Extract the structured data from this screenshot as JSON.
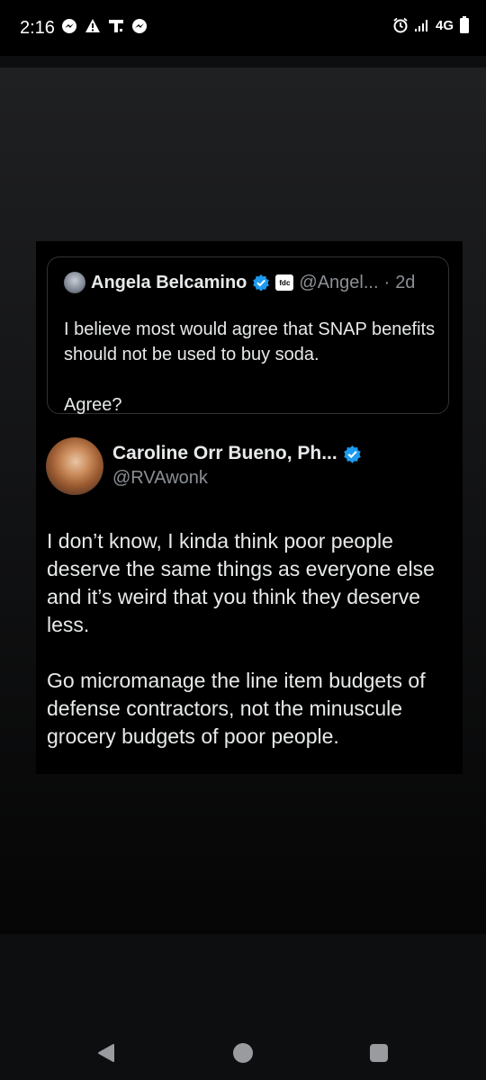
{
  "status_bar": {
    "time": "2:16",
    "left_icons": [
      "messenger-icon",
      "warning-icon",
      "t-icon",
      "messenger-icon"
    ],
    "network": "4G",
    "right_icons": [
      "alarm-icon",
      "signal-icon",
      "battery-icon"
    ]
  },
  "quoted_tweet": {
    "name": "Angela Belcamino",
    "verified": true,
    "affiliation_badge_text": "fdc",
    "handle": "@Angel...",
    "separator": "·",
    "time": "2d",
    "paragraphs": [
      "I believe most would agree that SNAP benefits should not be used to buy soda.",
      "Agree?"
    ]
  },
  "reply_tweet": {
    "name": "Caroline Orr Bueno, Ph...",
    "verified": true,
    "handle": "@RVAwonk",
    "paragraphs": [
      "I don’t know, I kinda think poor people deserve the same things as everyone else and it’s weird that you think they deserve less.",
      "Go micromanage the line item budgets of defense contractors, not the minuscule grocery budgets of poor people."
    ]
  },
  "nav_bar": {
    "buttons": [
      "back-icon",
      "home-icon",
      "recents-icon"
    ]
  },
  "colors": {
    "verified_blue": "#1d9bf0",
    "text_primary": "#e7e9ea",
    "text_muted": "#8b9096",
    "card_bg": "#000000"
  }
}
